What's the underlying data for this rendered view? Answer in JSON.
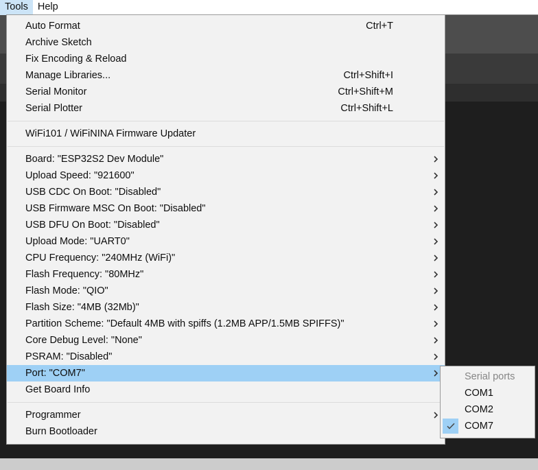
{
  "menubar": {
    "items": [
      {
        "label": "Tools",
        "active": true
      },
      {
        "label": "Help",
        "active": false
      }
    ]
  },
  "tools_menu": {
    "groups": [
      {
        "name": "basic-actions",
        "items": [
          {
            "label": "Auto Format",
            "shortcut": "Ctrl+T",
            "arrow": false
          },
          {
            "label": "Archive Sketch",
            "shortcut": "",
            "arrow": false
          },
          {
            "label": "Fix Encoding & Reload",
            "shortcut": "",
            "arrow": false
          },
          {
            "label": "Manage Libraries...",
            "shortcut": "Ctrl+Shift+I",
            "arrow": false
          },
          {
            "label": "Serial Monitor",
            "shortcut": "Ctrl+Shift+M",
            "arrow": false
          },
          {
            "label": "Serial Plotter",
            "shortcut": "Ctrl+Shift+L",
            "arrow": false
          }
        ]
      },
      {
        "name": "firmware-updater",
        "items": [
          {
            "label": "WiFi101 / WiFiNINA Firmware Updater",
            "shortcut": "",
            "arrow": false
          }
        ]
      },
      {
        "name": "board-configuration",
        "items": [
          {
            "label": "Board: \"ESP32S2 Dev Module\"",
            "shortcut": "",
            "arrow": true
          },
          {
            "label": "Upload Speed: \"921600\"",
            "shortcut": "",
            "arrow": true
          },
          {
            "label": "USB CDC On Boot: \"Disabled\"",
            "shortcut": "",
            "arrow": true
          },
          {
            "label": "USB Firmware MSC On Boot: \"Disabled\"",
            "shortcut": "",
            "arrow": true
          },
          {
            "label": "USB DFU On Boot: \"Disabled\"",
            "shortcut": "",
            "arrow": true
          },
          {
            "label": "Upload Mode: \"UART0\"",
            "shortcut": "",
            "arrow": true
          },
          {
            "label": "CPU Frequency: \"240MHz (WiFi)\"",
            "shortcut": "",
            "arrow": true
          },
          {
            "label": "Flash Frequency: \"80MHz\"",
            "shortcut": "",
            "arrow": true
          },
          {
            "label": "Flash Mode: \"QIO\"",
            "shortcut": "",
            "arrow": true
          },
          {
            "label": "Flash Size: \"4MB (32Mb)\"",
            "shortcut": "",
            "arrow": true
          },
          {
            "label": "Partition Scheme: \"Default 4MB with spiffs (1.2MB APP/1.5MB SPIFFS)\"",
            "shortcut": "",
            "arrow": true
          },
          {
            "label": "Core Debug Level: \"None\"",
            "shortcut": "",
            "arrow": true
          },
          {
            "label": "PSRAM: \"Disabled\"",
            "shortcut": "",
            "arrow": true
          },
          {
            "label": "Port: \"COM7\"",
            "shortcut": "",
            "arrow": true,
            "selected": true
          },
          {
            "label": "Get Board Info",
            "shortcut": "",
            "arrow": false
          }
        ]
      },
      {
        "name": "programmer-actions",
        "items": [
          {
            "label": "Programmer",
            "shortcut": "",
            "arrow": true
          },
          {
            "label": "Burn Bootloader",
            "shortcut": "",
            "arrow": false
          }
        ]
      }
    ]
  },
  "port_submenu": {
    "items": [
      {
        "label": "Serial ports",
        "header": true,
        "checked": false
      },
      {
        "label": "COM1",
        "header": false,
        "checked": false
      },
      {
        "label": "COM2",
        "header": false,
        "checked": false
      },
      {
        "label": "COM7",
        "header": false,
        "checked": true
      }
    ]
  },
  "colors": {
    "menu_background": "#f2f2f2",
    "highlight": "#9ed0f5",
    "menubar_highlight": "#cce4f7",
    "disabled_text": "#868686",
    "editor_background": "#1e1e1e"
  }
}
